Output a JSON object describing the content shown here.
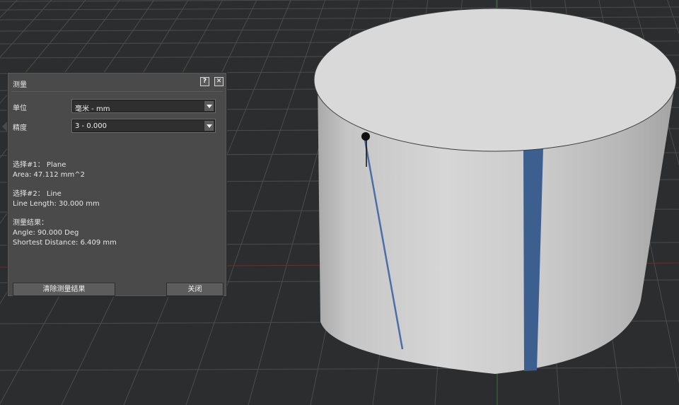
{
  "dialog": {
    "title": "测量",
    "help_label": "?",
    "close_label": "✕",
    "unit_label": "单位",
    "unit_value": "毫米 - mm",
    "precision_label": "精度",
    "precision_value": "3 - 0.000",
    "selection1_heading": "选择#1： Plane",
    "selection1_detail": "Area: 47.112 mm^2",
    "selection2_heading": "选择#2： Line",
    "selection2_detail": "Line Length: 30.000 mm",
    "result_heading": "测量结果：",
    "result_angle": "Angle: 90.000 Deg",
    "result_distance": "Shortest Distance: 6.409 mm",
    "clear_button": "清除测量结果",
    "close_button": "关闭"
  },
  "viewport": {
    "background_color": "#2b2d2f",
    "grid_color": "#4a4d50",
    "cylinder_top_color": "#d9d9d9",
    "cylinder_side_color": "#c8c8c8",
    "selected_face_color": "#3d5f8f",
    "selected_edge_color": "#4a6fa8",
    "x_axis_color": "#7a2a2a",
    "y_axis_color": "#2d6a35",
    "pin_icon": "measure-pin-icon"
  }
}
